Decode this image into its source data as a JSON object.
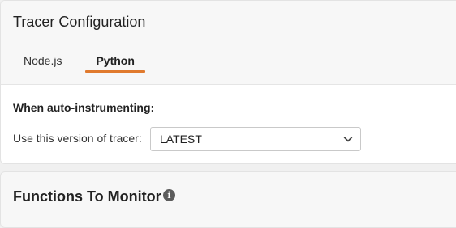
{
  "tracer_card": {
    "title": "Tracer Configuration",
    "tabs": [
      {
        "label": "Node.js",
        "active": false
      },
      {
        "label": "Python",
        "active": true
      }
    ],
    "auto_instrumenting_label": "When auto-instrumenting:",
    "version_label": "Use this version of tracer:",
    "version_select": {
      "value": "LATEST",
      "icon": "chevron-down-icon"
    },
    "accent_color": "#e07a2e"
  },
  "functions_card": {
    "title": "Functions To Monitor",
    "info_icon": "info-icon",
    "info_glyph": "i"
  }
}
